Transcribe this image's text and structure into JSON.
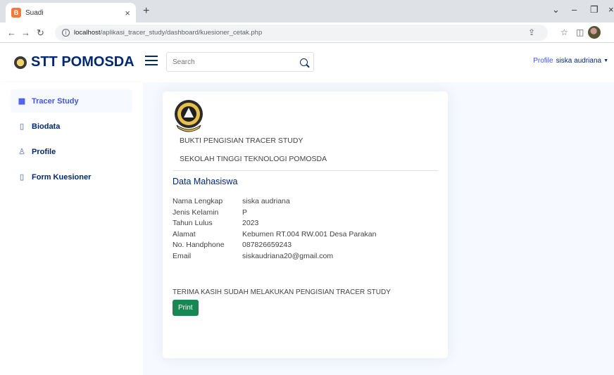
{
  "browser": {
    "tab_title": "Suadi",
    "tab_favicon": "B",
    "address_host": "localhost",
    "address_path": "/aplikasi_tracer_study/dashboard/kuesioner_cetak.php"
  },
  "navbar": {
    "brand": "STT POMOSDA",
    "search_placeholder": "Search",
    "profile_img_alt": "Profile",
    "profile_name": "siska audriana"
  },
  "sidebar": {
    "items": [
      {
        "label": "Tracer Study",
        "icon": "grid-icon"
      },
      {
        "label": "Biodata",
        "icon": "file-icon"
      },
      {
        "label": "Profile",
        "icon": "person-icon"
      },
      {
        "label": "Form Kuesioner",
        "icon": "document-icon"
      }
    ]
  },
  "card": {
    "line1": "BUKTI PENGISIAN TRACER STUDY",
    "line2": "SEKOLAH TINGGI TEKNOLOGI POMOSDA",
    "section_title": "Data Mahasiswa",
    "fields": [
      {
        "label": "Nama Lengkap",
        "value": "siska audriana"
      },
      {
        "label": "Jenis Kelamin",
        "value": "P"
      },
      {
        "label": "Tahun Lulus",
        "value": "2023"
      },
      {
        "label": "Alamat",
        "value": "Kebumen RT.004 RW.001 Desa Parakan"
      },
      {
        "label": "No. Handphone",
        "value": "087826659243"
      },
      {
        "label": "Email",
        "value": "siskaudriana20@gmail.com"
      }
    ],
    "thanks": "TERIMA KASIH SUDAH MELAKUKAN PENGISIAN TRACER STUDY",
    "print_label": "Print"
  },
  "colors": {
    "brand": "#012970",
    "accent": "#4154f1",
    "print_button": "#198754",
    "main_bg": "#f6f9ff"
  }
}
